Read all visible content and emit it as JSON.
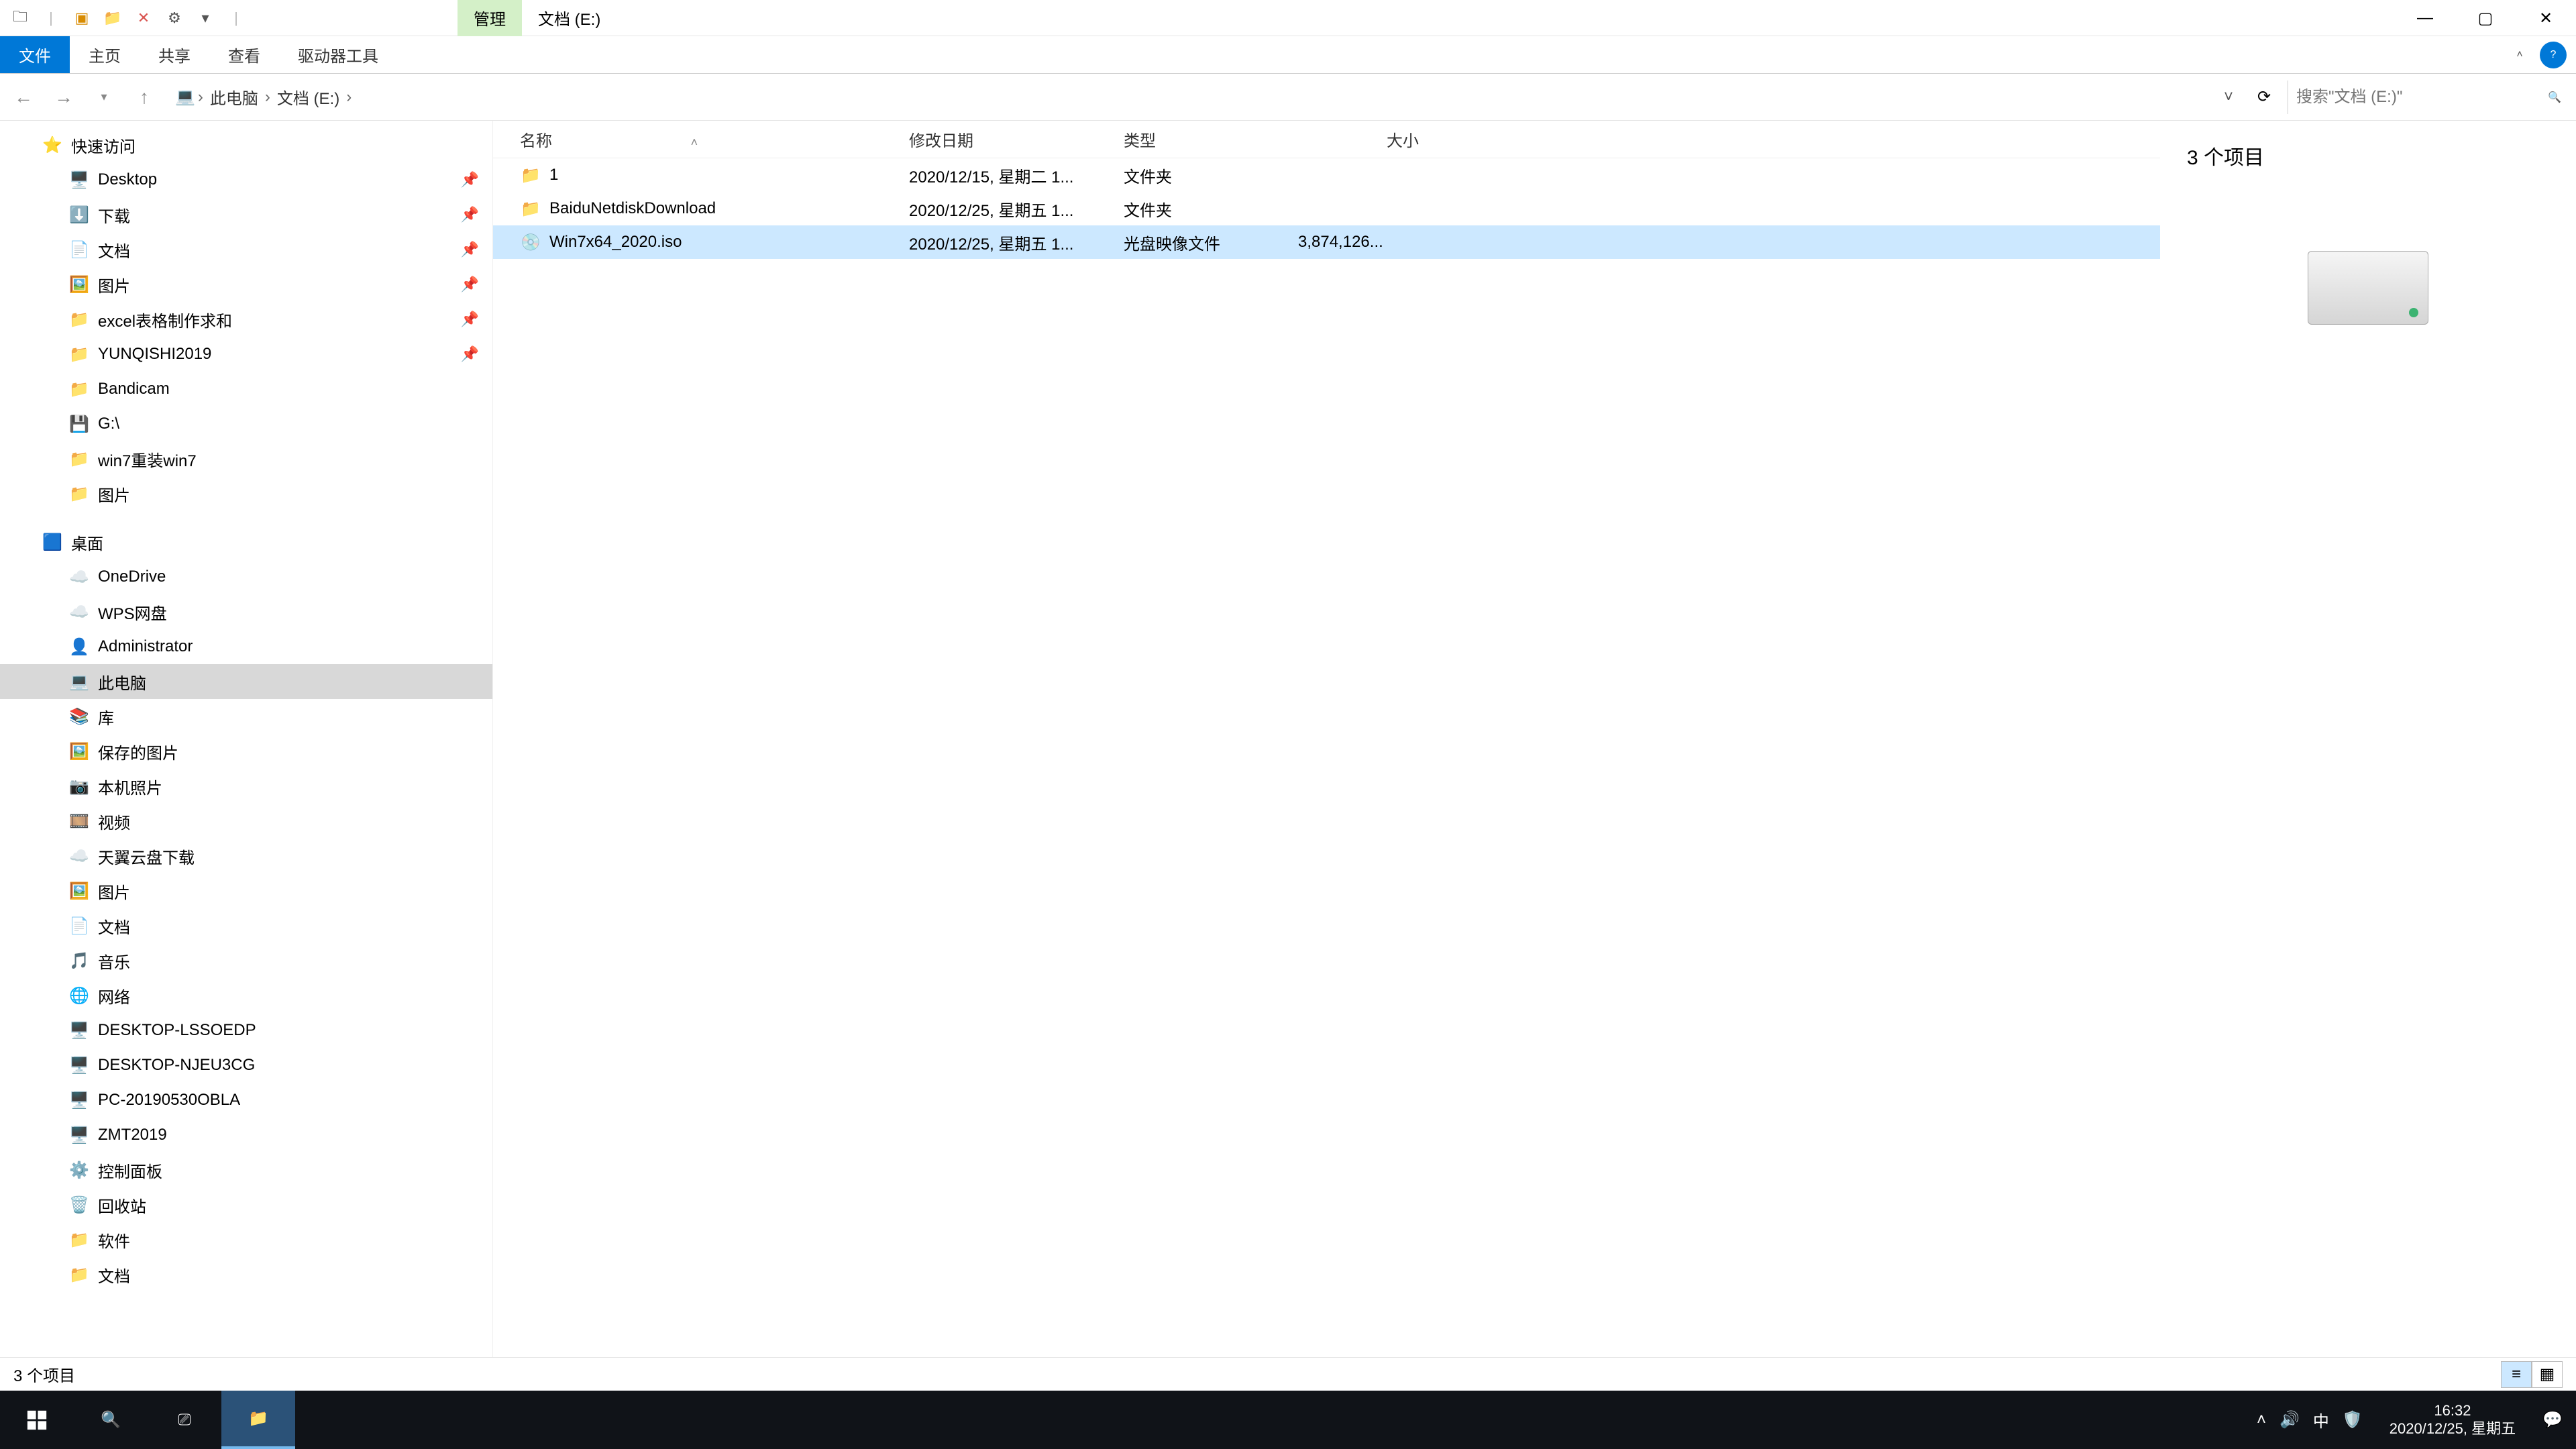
{
  "titlebar": {
    "context_tab": "管理",
    "title": "文档 (E:)"
  },
  "ribbon": {
    "file": "文件",
    "home": "主页",
    "share": "共享",
    "view": "查看",
    "drive_tools": "驱动器工具"
  },
  "nav": {
    "breadcrumb": [
      "此电脑",
      "文档 (E:)"
    ],
    "search_placeholder": "搜索\"文档 (E:)\""
  },
  "tree": {
    "quick_access": "快速访问",
    "items_qa": [
      {
        "label": "Desktop",
        "icon": "🖥️",
        "pin": true
      },
      {
        "label": "下载",
        "icon": "⬇️",
        "pin": true
      },
      {
        "label": "文档",
        "icon": "📄",
        "pin": true
      },
      {
        "label": "图片",
        "icon": "🖼️",
        "pin": true
      },
      {
        "label": "excel表格制作求和",
        "icon": "📁",
        "pin": true
      },
      {
        "label": "YUNQISHI2019",
        "icon": "📁",
        "pin": true
      },
      {
        "label": "Bandicam",
        "icon": "📁",
        "pin": false
      },
      {
        "label": "G:\\",
        "icon": "💾",
        "pin": false
      },
      {
        "label": "win7重装win7",
        "icon": "📁",
        "pin": false
      },
      {
        "label": "图片",
        "icon": "📁",
        "pin": false
      }
    ],
    "desktop": "桌面",
    "items_desktop": [
      {
        "label": "OneDrive",
        "icon": "☁️"
      },
      {
        "label": "WPS网盘",
        "icon": "☁️"
      },
      {
        "label": "Administrator",
        "icon": "👤"
      },
      {
        "label": "此电脑",
        "icon": "💻",
        "selected": true
      },
      {
        "label": "库",
        "icon": "📚"
      }
    ],
    "items_lib": [
      {
        "label": "保存的图片",
        "icon": "🖼️"
      },
      {
        "label": "本机照片",
        "icon": "📷"
      },
      {
        "label": "视频",
        "icon": "🎞️"
      },
      {
        "label": "天翼云盘下载",
        "icon": "☁️"
      },
      {
        "label": "图片",
        "icon": "🖼️"
      },
      {
        "label": "文档",
        "icon": "📄"
      },
      {
        "label": "音乐",
        "icon": "🎵"
      }
    ],
    "network": "网络",
    "items_net": [
      {
        "label": "DESKTOP-LSSOEDP",
        "icon": "🖥️"
      },
      {
        "label": "DESKTOP-NJEU3CG",
        "icon": "🖥️"
      },
      {
        "label": "PC-20190530OBLA",
        "icon": "🖥️"
      },
      {
        "label": "ZMT2019",
        "icon": "🖥️"
      }
    ],
    "control_panel": "控制面板",
    "recycle": "回收站",
    "software": "软件",
    "docs": "文档"
  },
  "columns": {
    "name": "名称",
    "date": "修改日期",
    "type": "类型",
    "size": "大小"
  },
  "files": [
    {
      "name": "1",
      "date": "2020/12/15, 星期二 1...",
      "type": "文件夹",
      "size": "",
      "kind": "folder",
      "selected": false
    },
    {
      "name": "BaiduNetdiskDownload",
      "date": "2020/12/25, 星期五 1...",
      "type": "文件夹",
      "size": "",
      "kind": "folder",
      "selected": false
    },
    {
      "name": "Win7x64_2020.iso",
      "date": "2020/12/25, 星期五 1...",
      "type": "光盘映像文件",
      "size": "3,874,126...",
      "kind": "iso",
      "selected": true
    }
  ],
  "preview": {
    "count_label": "3 个项目"
  },
  "status": {
    "left": "3 个项目"
  },
  "taskbar": {
    "time": "16:32",
    "date": "2020/12/25, 星期五",
    "ime": "中"
  }
}
